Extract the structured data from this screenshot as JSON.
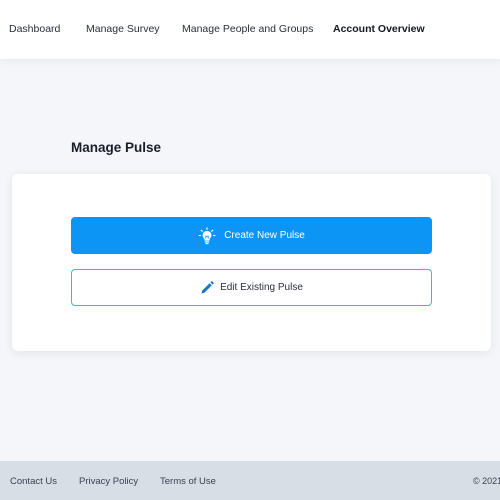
{
  "nav": {
    "items": [
      {
        "label": "Dashboard"
      },
      {
        "label": "Manage Survey"
      },
      {
        "label": "Manage People and Groups"
      },
      {
        "label": "Account Overview"
      }
    ]
  },
  "main": {
    "title": "Manage Pulse",
    "create_label": "Create New Pulse",
    "edit_label": "Edit Existing Pulse",
    "create_icon": "lightbulb-icon",
    "edit_icon": "pencil-icon"
  },
  "footer": {
    "links": [
      {
        "label": "Contact Us"
      },
      {
        "label": "Privacy Policy"
      },
      {
        "label": "Terms of Use"
      }
    ],
    "copyright": "© 2021"
  },
  "colors": {
    "primary": "#0d95f6",
    "outline": "#44aef2",
    "background": "#f4f6f9",
    "footer": "#d8dee6"
  }
}
